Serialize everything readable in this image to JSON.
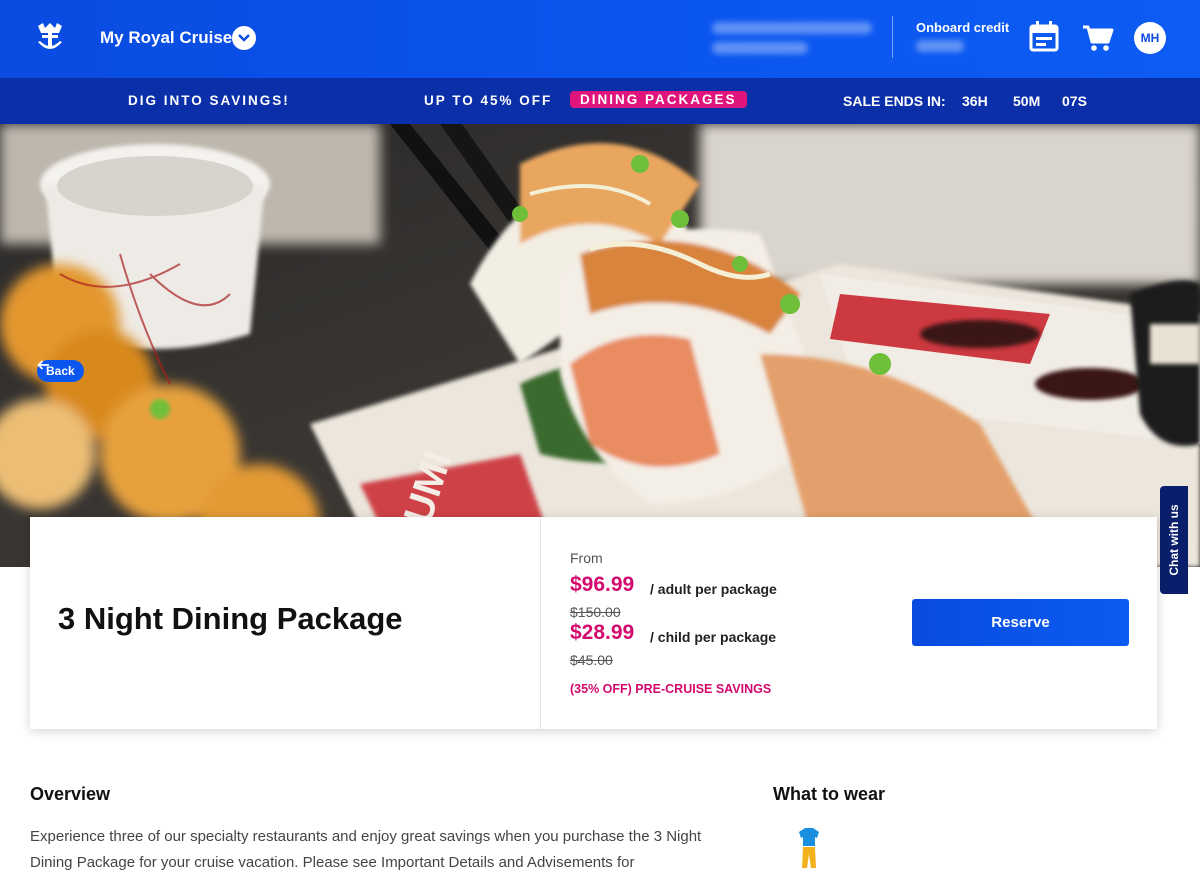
{
  "header": {
    "brand": "My Royal Cruise",
    "onboard_credit_label": "Onboard credit",
    "avatar_initials": "MH",
    "accent_color": "#0b56ef"
  },
  "promo": {
    "left_text": "DIG INTO SAVINGS!",
    "middle_text": "UP TO 45% OFF",
    "highlight_text": "DINING PACKAGES",
    "sale_label": "SALE ENDS IN:",
    "hours": "36H",
    "minutes": "50M",
    "seconds": "07S",
    "highlight_color": "#e0157b"
  },
  "hero": {
    "back_label": "Back",
    "carousel_slide_count": 2,
    "carousel_active_index": 1
  },
  "chat": {
    "label": "Chat with us"
  },
  "package": {
    "title": "3 Night Dining Package",
    "from_label": "From",
    "adult_price": "$96.99",
    "adult_unit": "/ adult per package",
    "adult_old_price": "$150.00",
    "child_price": "$28.99",
    "child_unit": "/ child per package",
    "child_old_price": "$45.00",
    "savings_text": "(35% OFF) PRE-CRUISE SAVINGS",
    "reserve_label": "Reserve",
    "price_color": "#d4096d"
  },
  "overview": {
    "heading": "Overview",
    "text_line1": "Experience three of our specialty restaurants and enjoy great savings when you purchase the 3 Night",
    "text_line2": "Dining Package for your cruise vacation. Please see Important Details and Advisements for"
  },
  "wear": {
    "heading": "What to wear",
    "icon": "casual-outfit-icon"
  }
}
